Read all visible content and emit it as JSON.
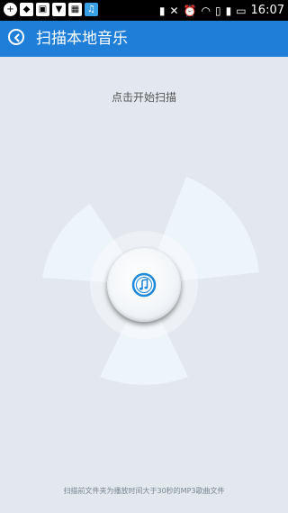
{
  "status_bar": {
    "time": "16:07",
    "left_icons": [
      "plus-icon",
      "diamond-icon",
      "bag-icon",
      "bookmark-icon",
      "image-icon",
      "app-icon"
    ],
    "right_icons": [
      "signal-bars-icon",
      "mute-icon",
      "alarm-icon",
      "wifi-icon",
      "battery-saver-icon",
      "signal-icon",
      "battery-icon"
    ]
  },
  "header": {
    "title": "扫描本地音乐"
  },
  "main": {
    "prompt": "点击开始扫描",
    "footer_note": "扫描前文件夹为播放时间大于30秒的MP3歌曲文件"
  },
  "colors": {
    "header": "#1f7fd8",
    "background": "#e3e8ee",
    "fan_blade": "#eef5fa",
    "icon_accent": "#1e88d8"
  }
}
